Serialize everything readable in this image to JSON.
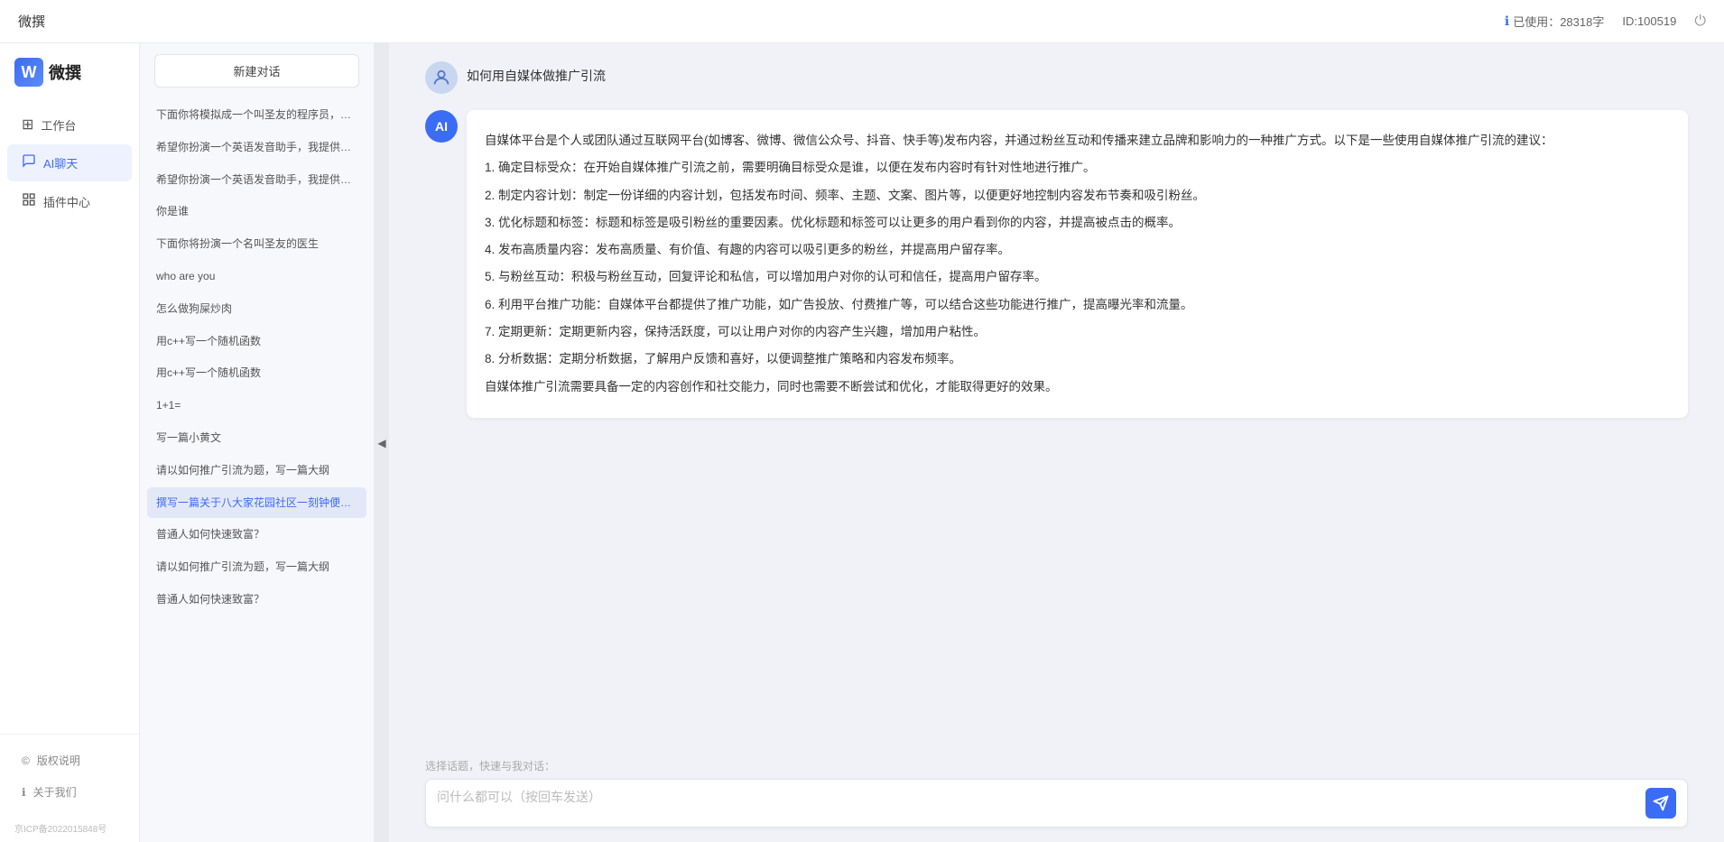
{
  "topbar": {
    "title": "微撰",
    "usage_label": "已使用：28318字",
    "id_label": "ID:100519",
    "usage_icon": "ℹ"
  },
  "sidebar": {
    "logo_letter": "W",
    "logo_text": "微撰",
    "nav_items": [
      {
        "id": "workbench",
        "label": "工作台",
        "icon": "⊞"
      },
      {
        "id": "ai-chat",
        "label": "AI聊天",
        "icon": "💬",
        "active": true
      },
      {
        "id": "plugin-center",
        "label": "插件中心",
        "icon": "🔌"
      }
    ],
    "footer_items": [
      {
        "id": "copyright",
        "label": "版权说明",
        "icon": "©"
      },
      {
        "id": "about",
        "label": "关于我们",
        "icon": "ℹ"
      }
    ],
    "icp": "京ICP备2022015848号"
  },
  "history": {
    "new_btn_label": "新建对话",
    "items": [
      {
        "id": 1,
        "text": "下面你将模拟成一个叫圣友的程序员，我说...",
        "active": false
      },
      {
        "id": 2,
        "text": "希望你扮演一个英语发音助手，我提供给你...",
        "active": false
      },
      {
        "id": 3,
        "text": "希望你扮演一个英语发音助手，我提供给你...",
        "active": false
      },
      {
        "id": 4,
        "text": "你是谁",
        "active": false
      },
      {
        "id": 5,
        "text": "下面你将扮演一个名叫圣友的医生",
        "active": false
      },
      {
        "id": 6,
        "text": "who are you",
        "active": false
      },
      {
        "id": 7,
        "text": "怎么做狗屎炒肉",
        "active": false
      },
      {
        "id": 8,
        "text": "用c++写一个随机函数",
        "active": false
      },
      {
        "id": 9,
        "text": "用c++写一个随机函数",
        "active": false
      },
      {
        "id": 10,
        "text": "1+1=",
        "active": false
      },
      {
        "id": 11,
        "text": "写一篇小黄文",
        "active": false
      },
      {
        "id": 12,
        "text": "请以如何推广引流为题，写一篇大纲",
        "active": false
      },
      {
        "id": 13,
        "text": "撰写一篇关于八大家花园社区一刻钟便民生...",
        "active": true
      },
      {
        "id": 14,
        "text": "普通人如何快速致富？",
        "active": false
      },
      {
        "id": 15,
        "text": "请以如何推广引流为题，写一篇大纲",
        "active": false
      },
      {
        "id": 16,
        "text": "普通人如何快速致富？",
        "active": false
      }
    ]
  },
  "chat": {
    "user_message": "如何用自媒体做推广引流",
    "ai_response": {
      "intro": "自媒体平台是个人或团队通过互联网平台(如博客、微博、微信公众号、抖音、快手等)发布内容，并通过粉丝互动和传播来建立品牌和影响力的一种推广方式。以下是一些使用自媒体推广引流的建议：",
      "points": [
        "1. 确定目标受众：在开始自媒体推广引流之前，需要明确目标受众是谁，以便在发布内容时有针对性地进行推广。",
        "2. 制定内容计划：制定一份详细的内容计划，包括发布时间、频率、主题、文案、图片等，以便更好地控制内容发布节奏和吸引粉丝。",
        "3. 优化标题和标签：标题和标签是吸引粉丝的重要因素。优化标题和标签可以让更多的用户看到你的内容，并提高被点击的概率。",
        "4. 发布高质量内容：发布高质量、有价值、有趣的内容可以吸引更多的粉丝，并提高用户留存率。",
        "5. 与粉丝互动：积极与粉丝互动，回复评论和私信，可以增加用户对你的认可和信任，提高用户留存率。",
        "6. 利用平台推广功能：自媒体平台都提供了推广功能，如广告投放、付费推广等，可以结合这些功能进行推广，提高曝光率和流量。",
        "7. 定期更新：定期更新内容，保持活跃度，可以让用户对你的内容产生兴趣，增加用户粘性。",
        "8. 分析数据：定期分析数据，了解用户反馈和喜好，以便调整推广策略和内容发布频率。"
      ],
      "conclusion": "自媒体推广引流需要具备一定的内容创作和社交能力，同时也需要不断尝试和优化，才能取得更好的效果。"
    },
    "input_placeholder": "问什么都可以（按回车发送）",
    "quick_hint": "选择话题，快速与我对话："
  }
}
